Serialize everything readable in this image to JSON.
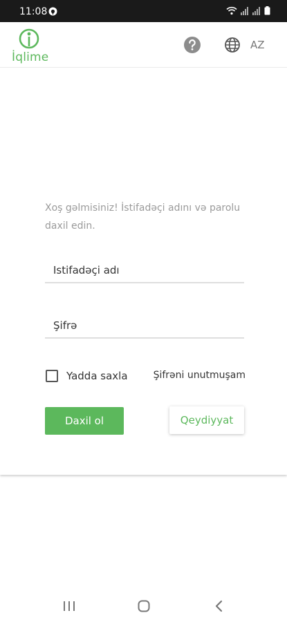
{
  "status_bar": {
    "time": "11:08",
    "icons": [
      "app-notification-icon",
      "wifi-icon",
      "signal-icon",
      "signal-icon",
      "battery-icon"
    ]
  },
  "header": {
    "logo_text": "İqlime",
    "help_icon": "question-circle-icon",
    "language_icon": "globe-icon",
    "language_code": "AZ"
  },
  "login": {
    "welcome_text": "Xoş gəlmisiniz! İstifadəçi adını və parolu daxil edin.",
    "username_placeholder": "Istifadəçi adı",
    "password_placeholder": "Şifrə",
    "remember_label": "Yadda saxla",
    "remember_checked": false,
    "forgot_label": "Şifrəni unutmuşam",
    "login_button": "Daxil ol",
    "register_button": "Qeydiyyat"
  },
  "colors": {
    "brand_green": "#5cb85c",
    "status_bar_bg": "#1a1a1a",
    "muted_text": "#9a9a9a"
  },
  "nav_bar": {
    "icons": [
      "recent-apps-icon",
      "home-icon",
      "back-icon"
    ]
  }
}
